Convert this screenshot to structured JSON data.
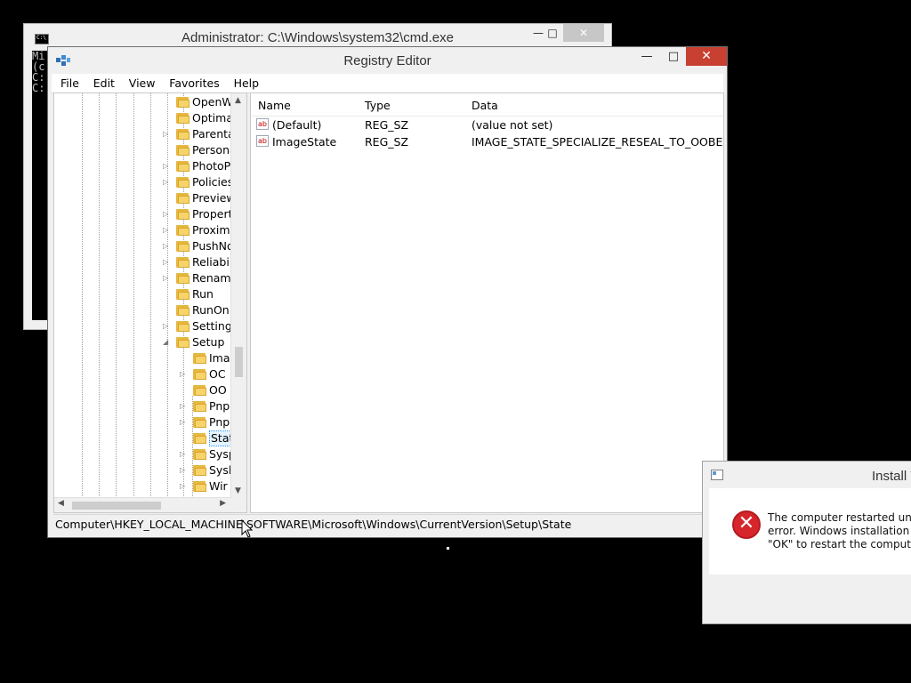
{
  "cmd": {
    "title": "Administrator: C:\\Windows\\system32\\cmd.exe",
    "minimize": "—",
    "maximize": "□",
    "close": "✕",
    "console_lines": [
      "Mi",
      "(c",
      "",
      "C:",
      "",
      "C:"
    ]
  },
  "regedit": {
    "title": "Registry Editor",
    "minimize": "—",
    "maximize": "□",
    "close": "✕",
    "menu": [
      "File",
      "Edit",
      "View",
      "Favorites",
      "Help"
    ],
    "tree": [
      {
        "label": "OpenW",
        "arrow": "",
        "level": 1
      },
      {
        "label": "Optima",
        "arrow": "",
        "level": 1
      },
      {
        "label": "Parenta",
        "arrow": "▷",
        "level": 1
      },
      {
        "label": "Persona",
        "arrow": "",
        "level": 1
      },
      {
        "label": "PhotoP",
        "arrow": "▷",
        "level": 1
      },
      {
        "label": "Policies",
        "arrow": "▷",
        "level": 1
      },
      {
        "label": "Preview",
        "arrow": "",
        "level": 1
      },
      {
        "label": "Propert",
        "arrow": "▷",
        "level": 1
      },
      {
        "label": "Proxim",
        "arrow": "▷",
        "level": 1
      },
      {
        "label": "PushNo",
        "arrow": "▷",
        "level": 1
      },
      {
        "label": "Reliabil",
        "arrow": "▷",
        "level": 1
      },
      {
        "label": "Renam",
        "arrow": "▷",
        "level": 1
      },
      {
        "label": "Run",
        "arrow": "",
        "level": 1
      },
      {
        "label": "RunOn",
        "arrow": "",
        "level": 1
      },
      {
        "label": "Setting",
        "arrow": "▷",
        "level": 1
      },
      {
        "label": "Setup",
        "arrow": "◢",
        "level": 1
      },
      {
        "label": "Ima",
        "arrow": "",
        "level": 2
      },
      {
        "label": "OC",
        "arrow": "▷",
        "level": 2
      },
      {
        "label": "OO",
        "arrow": "",
        "level": 2
      },
      {
        "label": "Pnp",
        "arrow": "▷",
        "level": 2
      },
      {
        "label": "Pnp",
        "arrow": "▷",
        "level": 2
      },
      {
        "label": "Stat",
        "arrow": "",
        "level": 2,
        "selected": true
      },
      {
        "label": "Sysp",
        "arrow": "▷",
        "level": 2
      },
      {
        "label": "Sysl",
        "arrow": "▷",
        "level": 2
      },
      {
        "label": "Wir",
        "arrow": "▷",
        "level": 2
      }
    ],
    "columns": {
      "name": "Name",
      "type": "Type",
      "data": "Data"
    },
    "values": [
      {
        "name": "(Default)",
        "type": "REG_SZ",
        "data": "(value not set)"
      },
      {
        "name": "ImageState",
        "type": "REG_SZ",
        "data": "IMAGE_STATE_SPECIALIZE_RESEAL_TO_OOBE"
      }
    ],
    "status_path": "Computer\\HKEY_LOCAL_MACHINE\\SOFTWARE\\Microsoft\\Windows\\CurrentVersion\\Setup\\State"
  },
  "install_dialog": {
    "title": "Install V",
    "message_lines": [
      "The computer restarted unexpe",
      "error. Windows installation can",
      "\"OK\" to restart the computer, a"
    ]
  }
}
